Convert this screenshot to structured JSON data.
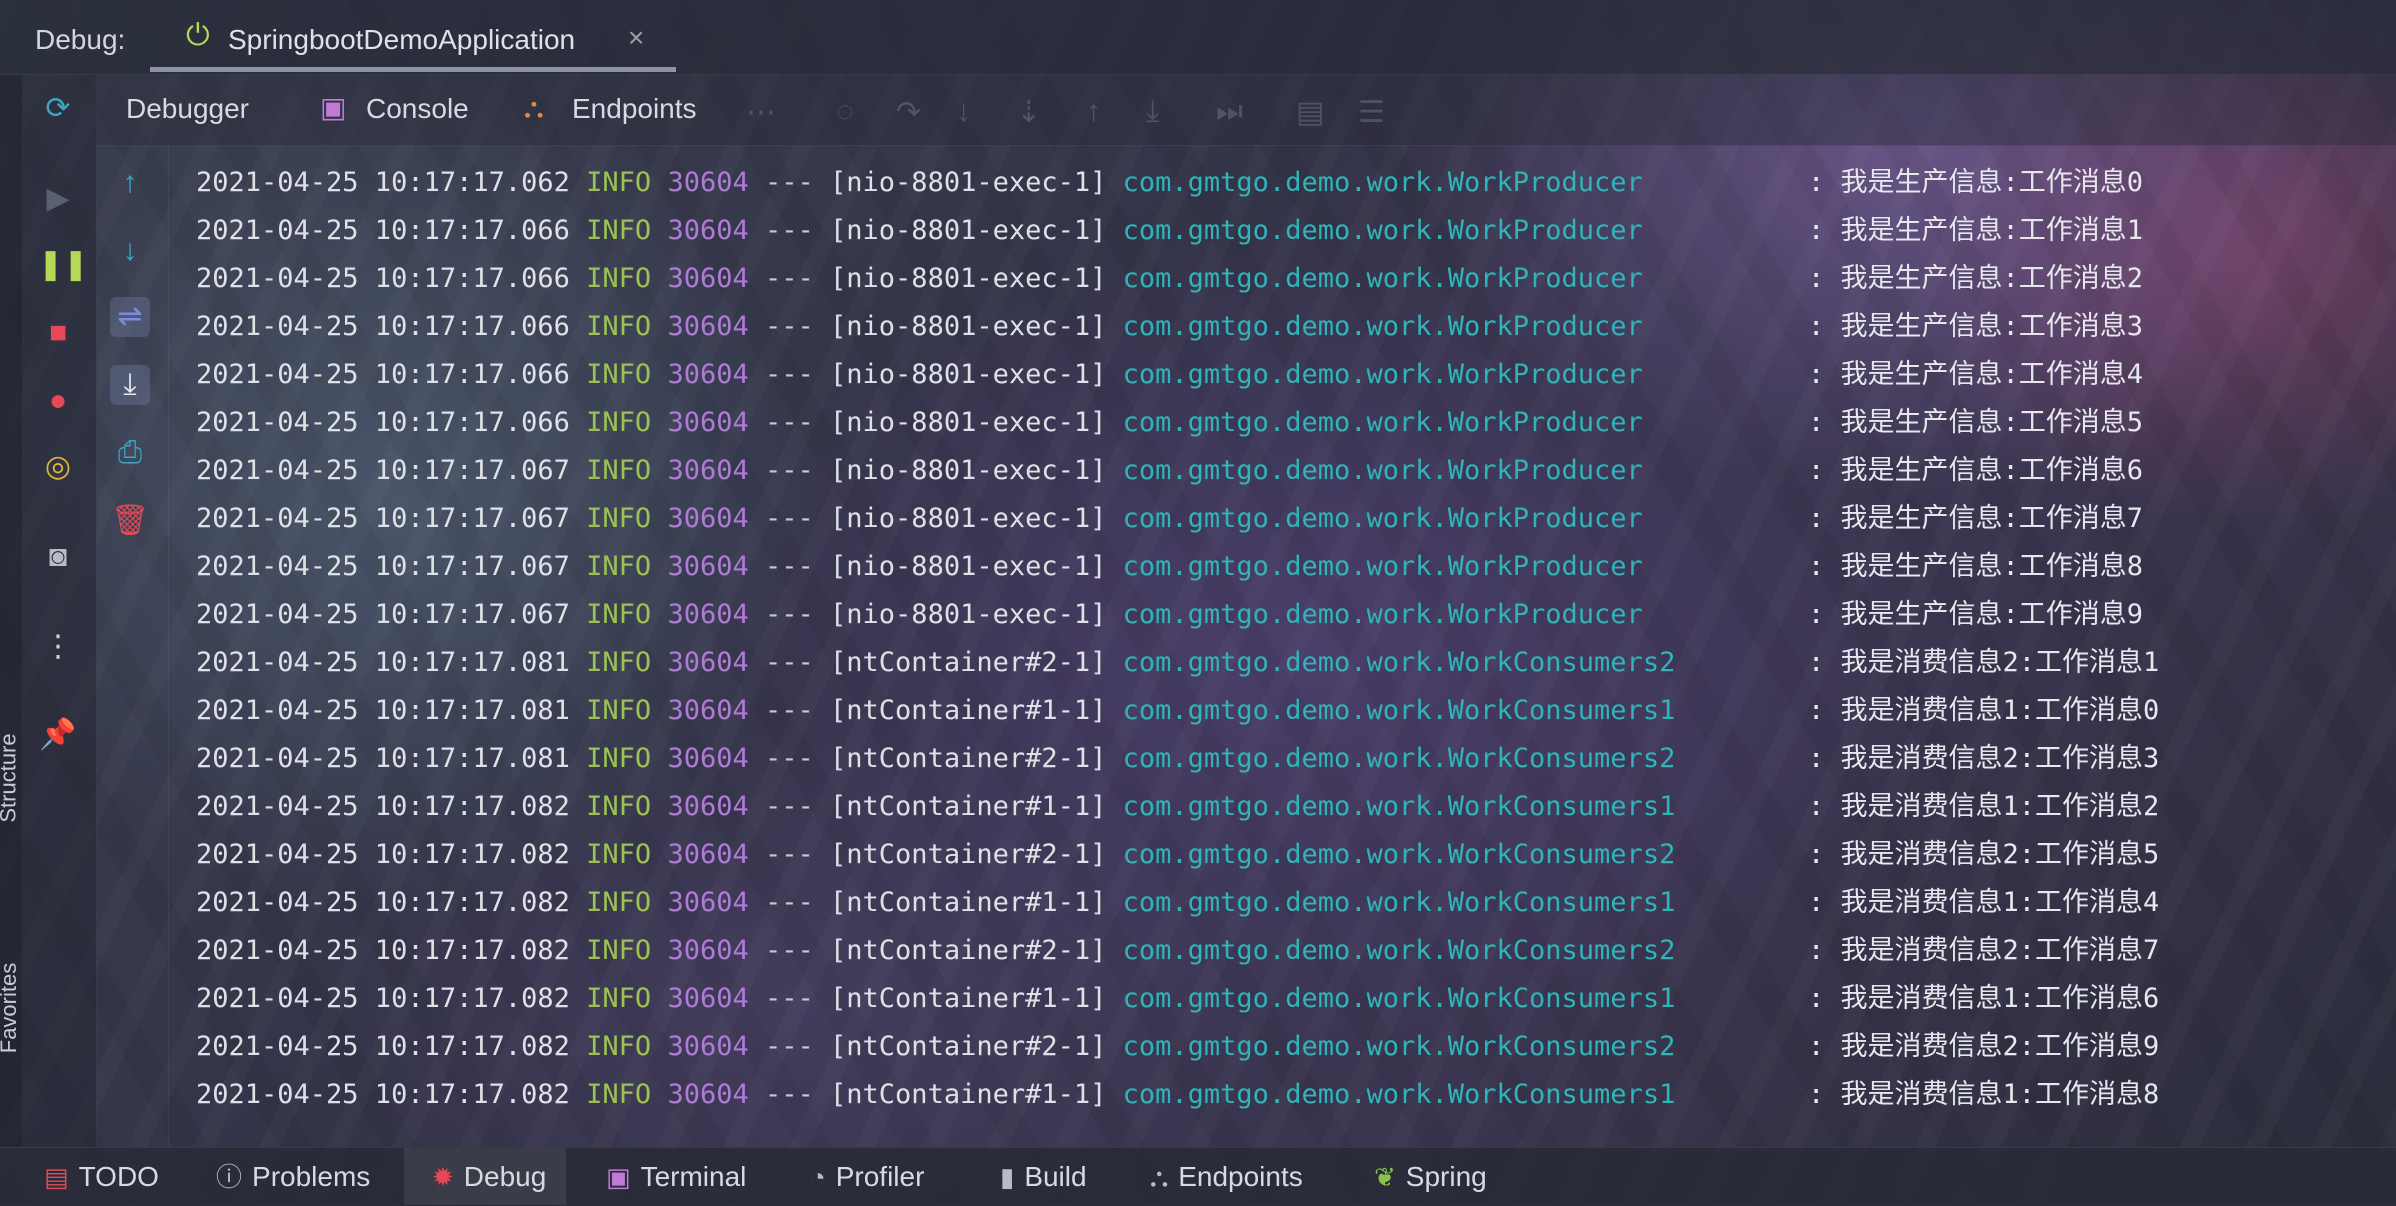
{
  "window": {
    "debug_label": "Debug:",
    "run_config_name": "SpringbootDemoApplication",
    "close_glyph": "×"
  },
  "toolbar": {
    "tabs": [
      {
        "label": "Debugger",
        "icon": "debugger-icon"
      },
      {
        "label": "Console",
        "icon": "console-icon"
      },
      {
        "label": "Endpoints",
        "icon": "endpoints-icon"
      }
    ]
  },
  "side_labels": {
    "structure": "Structure",
    "favorites": "Favorites"
  },
  "colors": {
    "timestamp": "#dfe1e7",
    "level": "#9ac34f",
    "pid": "#b07ad8",
    "class": "#2fb4b9",
    "stop": "#e54857",
    "resume": "#b5d957"
  },
  "console": {
    "lines": [
      {
        "ts": "2021-04-25 10:17:17.062",
        "level": "INFO",
        "pid": "30604",
        "sep": "---",
        "thread": "[nio-8801-exec-1]",
        "cls": "com.gmtgo.demo.work.WorkProducer",
        "msg": ": 我是生产信息:工作消息0"
      },
      {
        "ts": "2021-04-25 10:17:17.066",
        "level": "INFO",
        "pid": "30604",
        "sep": "---",
        "thread": "[nio-8801-exec-1]",
        "cls": "com.gmtgo.demo.work.WorkProducer",
        "msg": ": 我是生产信息:工作消息1"
      },
      {
        "ts": "2021-04-25 10:17:17.066",
        "level": "INFO",
        "pid": "30604",
        "sep": "---",
        "thread": "[nio-8801-exec-1]",
        "cls": "com.gmtgo.demo.work.WorkProducer",
        "msg": ": 我是生产信息:工作消息2"
      },
      {
        "ts": "2021-04-25 10:17:17.066",
        "level": "INFO",
        "pid": "30604",
        "sep": "---",
        "thread": "[nio-8801-exec-1]",
        "cls": "com.gmtgo.demo.work.WorkProducer",
        "msg": ": 我是生产信息:工作消息3"
      },
      {
        "ts": "2021-04-25 10:17:17.066",
        "level": "INFO",
        "pid": "30604",
        "sep": "---",
        "thread": "[nio-8801-exec-1]",
        "cls": "com.gmtgo.demo.work.WorkProducer",
        "msg": ": 我是生产信息:工作消息4"
      },
      {
        "ts": "2021-04-25 10:17:17.066",
        "level": "INFO",
        "pid": "30604",
        "sep": "---",
        "thread": "[nio-8801-exec-1]",
        "cls": "com.gmtgo.demo.work.WorkProducer",
        "msg": ": 我是生产信息:工作消息5"
      },
      {
        "ts": "2021-04-25 10:17:17.067",
        "level": "INFO",
        "pid": "30604",
        "sep": "---",
        "thread": "[nio-8801-exec-1]",
        "cls": "com.gmtgo.demo.work.WorkProducer",
        "msg": ": 我是生产信息:工作消息6"
      },
      {
        "ts": "2021-04-25 10:17:17.067",
        "level": "INFO",
        "pid": "30604",
        "sep": "---",
        "thread": "[nio-8801-exec-1]",
        "cls": "com.gmtgo.demo.work.WorkProducer",
        "msg": ": 我是生产信息:工作消息7"
      },
      {
        "ts": "2021-04-25 10:17:17.067",
        "level": "INFO",
        "pid": "30604",
        "sep": "---",
        "thread": "[nio-8801-exec-1]",
        "cls": "com.gmtgo.demo.work.WorkProducer",
        "msg": ": 我是生产信息:工作消息8"
      },
      {
        "ts": "2021-04-25 10:17:17.067",
        "level": "INFO",
        "pid": "30604",
        "sep": "---",
        "thread": "[nio-8801-exec-1]",
        "cls": "com.gmtgo.demo.work.WorkProducer",
        "msg": ": 我是生产信息:工作消息9"
      },
      {
        "ts": "2021-04-25 10:17:17.081",
        "level": "INFO",
        "pid": "30604",
        "sep": "---",
        "thread": "[ntContainer#2-1]",
        "cls": "com.gmtgo.demo.work.WorkConsumers2",
        "msg": ": 我是消费信息2:工作消息1"
      },
      {
        "ts": "2021-04-25 10:17:17.081",
        "level": "INFO",
        "pid": "30604",
        "sep": "---",
        "thread": "[ntContainer#1-1]",
        "cls": "com.gmtgo.demo.work.WorkConsumers1",
        "msg": ": 我是消费信息1:工作消息0"
      },
      {
        "ts": "2021-04-25 10:17:17.081",
        "level": "INFO",
        "pid": "30604",
        "sep": "---",
        "thread": "[ntContainer#2-1]",
        "cls": "com.gmtgo.demo.work.WorkConsumers2",
        "msg": ": 我是消费信息2:工作消息3"
      },
      {
        "ts": "2021-04-25 10:17:17.082",
        "level": "INFO",
        "pid": "30604",
        "sep": "---",
        "thread": "[ntContainer#1-1]",
        "cls": "com.gmtgo.demo.work.WorkConsumers1",
        "msg": ": 我是消费信息1:工作消息2"
      },
      {
        "ts": "2021-04-25 10:17:17.082",
        "level": "INFO",
        "pid": "30604",
        "sep": "---",
        "thread": "[ntContainer#2-1]",
        "cls": "com.gmtgo.demo.work.WorkConsumers2",
        "msg": ": 我是消费信息2:工作消息5"
      },
      {
        "ts": "2021-04-25 10:17:17.082",
        "level": "INFO",
        "pid": "30604",
        "sep": "---",
        "thread": "[ntContainer#1-1]",
        "cls": "com.gmtgo.demo.work.WorkConsumers1",
        "msg": ": 我是消费信息1:工作消息4"
      },
      {
        "ts": "2021-04-25 10:17:17.082",
        "level": "INFO",
        "pid": "30604",
        "sep": "---",
        "thread": "[ntContainer#2-1]",
        "cls": "com.gmtgo.demo.work.WorkConsumers2",
        "msg": ": 我是消费信息2:工作消息7"
      },
      {
        "ts": "2021-04-25 10:17:17.082",
        "level": "INFO",
        "pid": "30604",
        "sep": "---",
        "thread": "[ntContainer#1-1]",
        "cls": "com.gmtgo.demo.work.WorkConsumers1",
        "msg": ": 我是消费信息1:工作消息6"
      },
      {
        "ts": "2021-04-25 10:17:17.082",
        "level": "INFO",
        "pid": "30604",
        "sep": "---",
        "thread": "[ntContainer#2-1]",
        "cls": "com.gmtgo.demo.work.WorkConsumers2",
        "msg": ": 我是消费信息2:工作消息9"
      },
      {
        "ts": "2021-04-25 10:17:17.082",
        "level": "INFO",
        "pid": "30604",
        "sep": "---",
        "thread": "[ntContainer#1-1]",
        "cls": "com.gmtgo.demo.work.WorkConsumers1",
        "msg": ": 我是消费信息1:工作消息8"
      }
    ]
  },
  "statusbar": {
    "items": [
      {
        "label": "TODO",
        "icon": "todo-icon"
      },
      {
        "label": "Problems",
        "icon": "problems-icon"
      },
      {
        "label": "Debug",
        "icon": "bug-icon"
      },
      {
        "label": "Terminal",
        "icon": "terminal-icon"
      },
      {
        "label": "Profiler",
        "icon": "profiler-icon"
      },
      {
        "label": "Build",
        "icon": "build-icon"
      },
      {
        "label": "Endpoints",
        "icon": "endpoints-icon"
      },
      {
        "label": "Spring",
        "icon": "spring-icon"
      }
    ]
  }
}
